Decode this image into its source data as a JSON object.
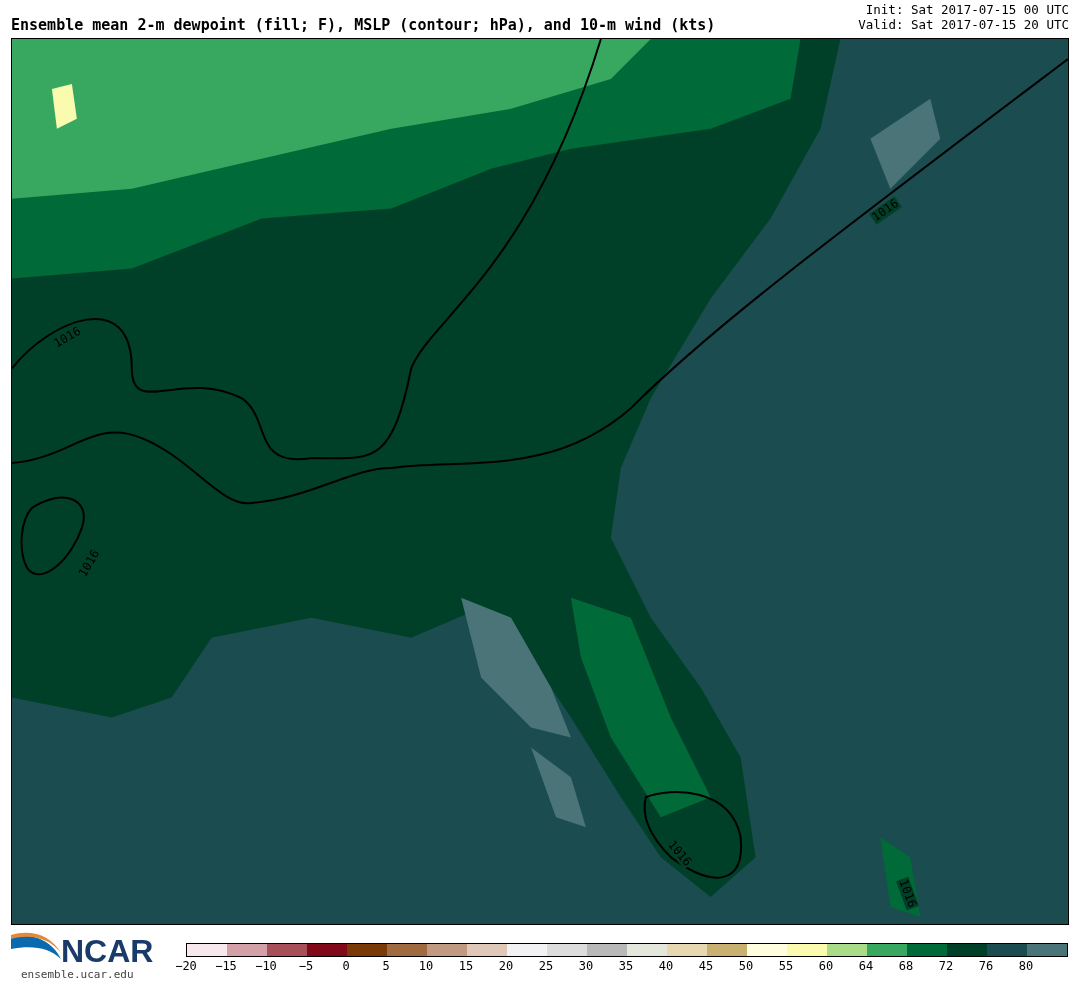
{
  "title": "Ensemble mean 2-m dewpoint (fill; F), MSLP (contour; hPa), and 10-m wind (kts)",
  "init": "Init: Sat 2017-07-15 00 UTC",
  "valid": "Valid: Sat 2017-07-15 20 UTC",
  "map": {
    "contour_labels": [
      "1016",
      "1016",
      "1016",
      "1016",
      "1016"
    ]
  },
  "logo": {
    "text": "NCAR",
    "site": "ensemble.ucar.edu"
  },
  "colorbar": {
    "swatches": [
      {
        "color": "#f7e8ee"
      },
      {
        "color": "#d4a0a8"
      },
      {
        "color": "#a8505a"
      },
      {
        "color": "#800a1a"
      },
      {
        "color": "#7a3a08"
      },
      {
        "color": "#a06a40"
      },
      {
        "color": "#c09a80"
      },
      {
        "color": "#e0c8b8"
      },
      {
        "color": "#f2f2f4"
      },
      {
        "color": "#dcdcdc"
      },
      {
        "color": "#b8b8b8"
      },
      {
        "color": "#e4e8dc"
      },
      {
        "color": "#e6d8b0"
      },
      {
        "color": "#c8b070"
      },
      {
        "color": "#ffffe0"
      },
      {
        "color": "#fbfbb0"
      },
      {
        "color": "#a8dc88"
      },
      {
        "color": "#38a860"
      },
      {
        "color": "#006a38"
      },
      {
        "color": "#004028"
      },
      {
        "color": "#1a4c50"
      },
      {
        "color": "#4a7478"
      }
    ],
    "ticks": [
      "−20",
      "−15",
      "−10",
      "−5",
      "0",
      "5",
      "10",
      "15",
      "20",
      "25",
      "30",
      "35",
      "40",
      "45",
      "50",
      "55",
      "60",
      "64",
      "68",
      "72",
      "76",
      "80"
    ]
  }
}
